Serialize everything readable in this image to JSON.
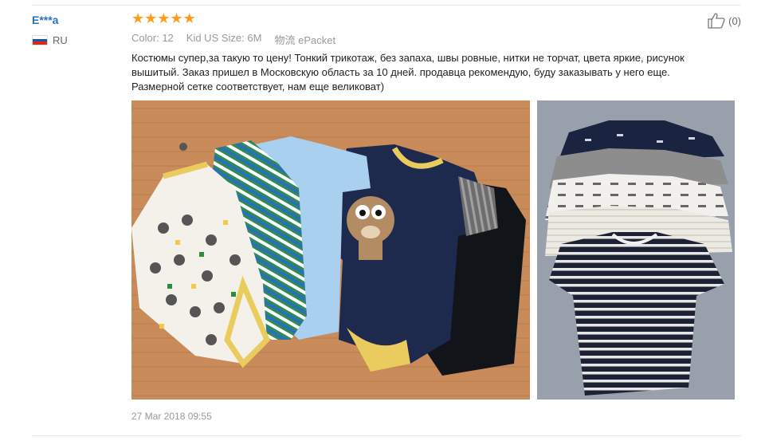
{
  "review": {
    "user_name": "E***a",
    "country_code": "RU",
    "rating": 5,
    "like_count": "(0)",
    "meta": {
      "color_label": "Color:",
      "color_value": "12",
      "size_label": "Kid US Size:",
      "size_value": "6M",
      "shipping_label": "物流",
      "shipping_value": "ePacket"
    },
    "text": "Костюмы супер,за такую то цену! Тонкий трикотаж, без запаха, швы ровные, нитки не торчат, цвета яркие, рисунок вышитый. Заказ пришел в Московскую область за 10 дней. продавца рекомендую, буду заказывать у него еще. Размерной сетке соответствует, нам еще великоват)",
    "date": "27 Mar 2018 09:55",
    "photos": [
      "review-photo-1",
      "review-photo-2"
    ]
  },
  "colors": {
    "username": "#2a6fc0",
    "star": "#ff9c1a",
    "muted": "#999999",
    "flag": [
      "#ffffff",
      "#1c57a5",
      "#d52b1e"
    ]
  },
  "icons": {
    "star": "star-icon",
    "like": "thumbs-up-icon",
    "flag": "russia-flag-icon"
  }
}
